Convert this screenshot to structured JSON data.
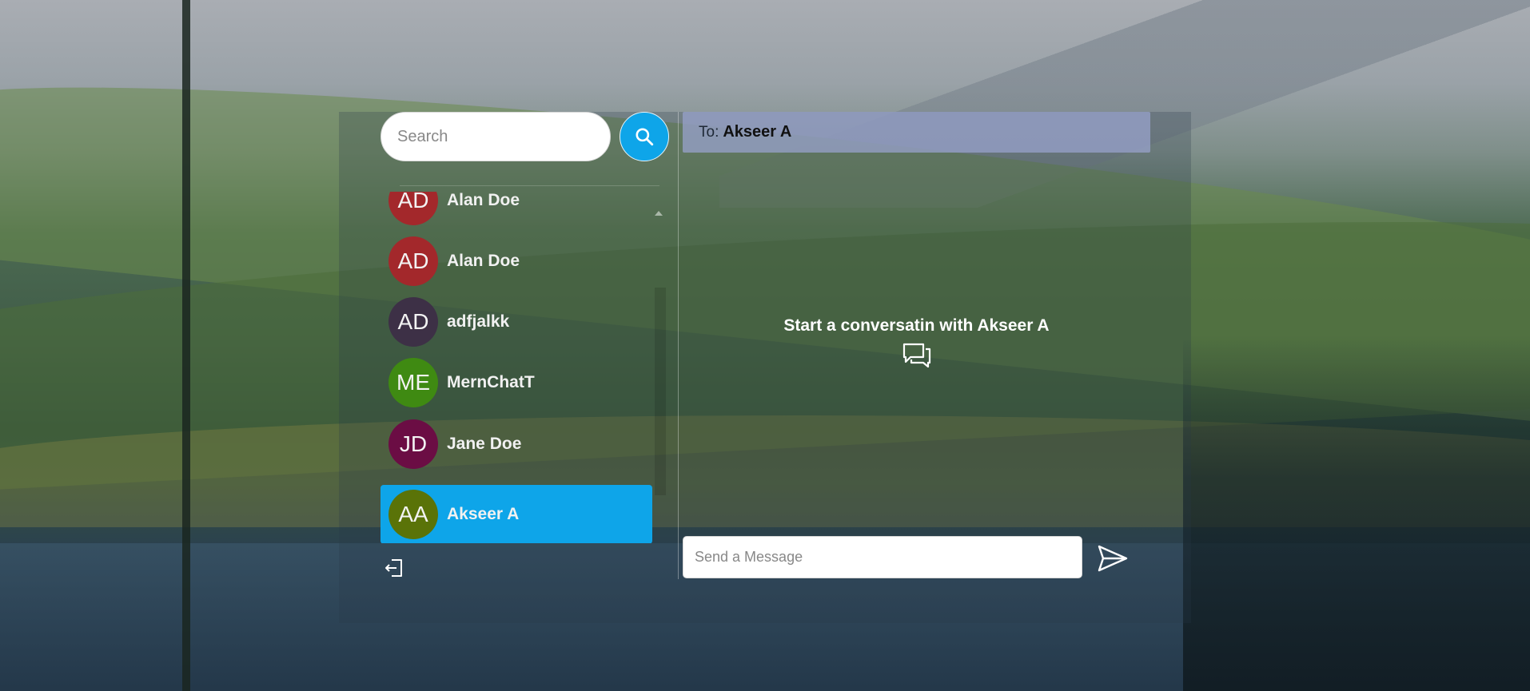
{
  "search": {
    "placeholder": "Search"
  },
  "contacts": [
    {
      "initials": "AD",
      "name": "Alan Doe",
      "color": "#a3282b"
    },
    {
      "initials": "AD",
      "name": "Alan Doe",
      "color": "#a3282b"
    },
    {
      "initials": "AD",
      "name": "adfjalkk",
      "color": "#3d3046"
    },
    {
      "initials": "ME",
      "name": "MernChatT",
      "color": "#3f8a12"
    },
    {
      "initials": "JD",
      "name": "Jane Doe",
      "color": "#6b0d44"
    },
    {
      "initials": "AA",
      "name": "Akseer A",
      "color": "#5a7308",
      "active": true
    }
  ],
  "chat": {
    "to_label": "To:",
    "to_name": "Akseer A",
    "empty_message": "Start a conversatin with Akseer A",
    "message_placeholder": "Send a Message"
  },
  "colors": {
    "accent": "#0ea5e9",
    "to_bar": "#96a0c8"
  },
  "icons": {
    "search": "search-icon",
    "chat": "chat-bubbles-icon",
    "logout": "logout-icon",
    "send": "send-icon"
  }
}
